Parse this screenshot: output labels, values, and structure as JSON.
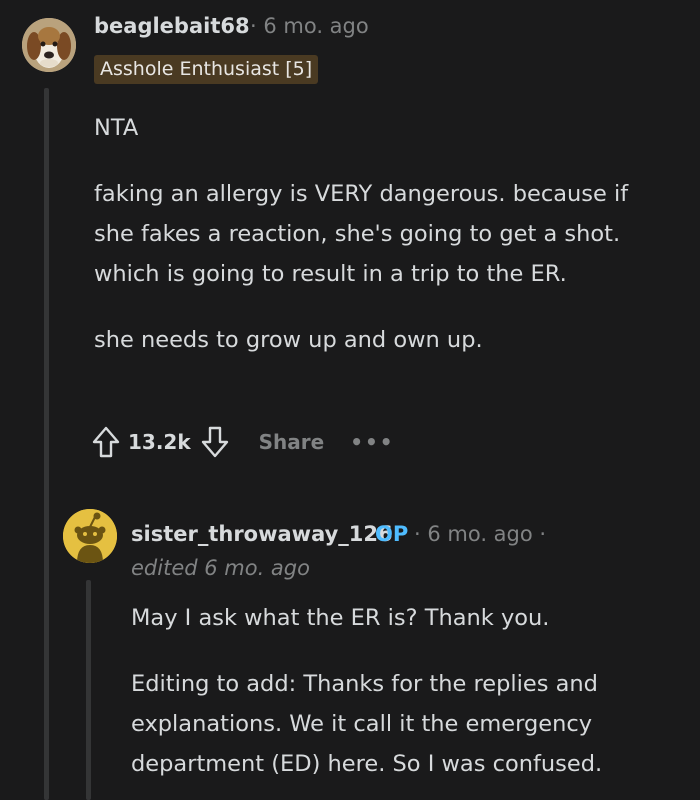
{
  "comment": {
    "username": "beaglebait68",
    "timestamp": "· 6 mo. ago",
    "flair": "Asshole Enthusiast [5]",
    "paragraphs": [
      "NTA",
      "faking an allergy is VERY dangerous. because if she fakes a reaction, she's going to get a shot. which is going to result in a trip to the ER.",
      "she needs to grow up and own up."
    ],
    "vote_count": "13.2k",
    "share_label": "Share",
    "more_label": "•••",
    "icons": [
      "upvote-icon",
      "downvote-icon",
      "more-options-icon"
    ]
  },
  "reply": {
    "username": "sister_throwaway_126",
    "op_badge": "OP",
    "timestamp": "· 6 mo. ago ·",
    "edited": "edited 6 mo. ago",
    "paragraphs": [
      "May I ask what the ER is? Thank you.",
      "Editing to add: Thanks for the replies and explanations. We it call it the emergency department (ED) here. So I was confused."
    ]
  },
  "colors": {
    "background": "#1a1a1b",
    "text": "#d7dadc",
    "muted": "#818384",
    "op_blue": "#4fbcff",
    "flair_bg": "#4a3a22",
    "snoo_yellow": "#e5c041"
  }
}
